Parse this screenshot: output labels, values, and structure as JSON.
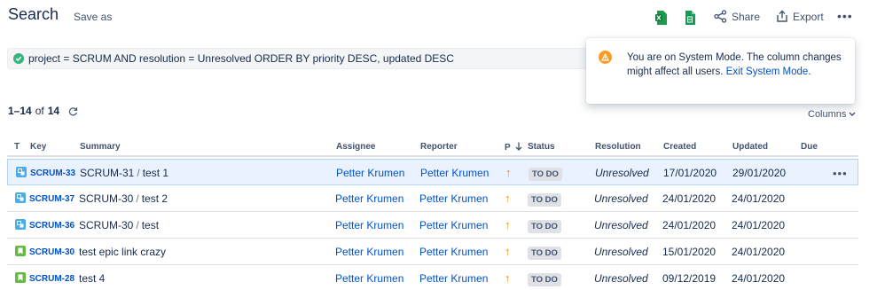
{
  "header": {
    "title": "Search",
    "save_as": "Save as",
    "share": "Share",
    "export": "Export",
    "more": "•••"
  },
  "jql": {
    "query": "project = SCRUM AND resolution = Unresolved ORDER BY priority DESC, updated DESC"
  },
  "popup": {
    "message": "You are on System Mode. The column changes might affect all users.",
    "link": "Exit System Mode",
    "suffix": "."
  },
  "results": {
    "range": "1–14",
    "of": "of",
    "total": "14",
    "columns_label": "Columns"
  },
  "table": {
    "headers": {
      "type": "T",
      "key": "Key",
      "summary": "Summary",
      "assignee": "Assignee",
      "reporter": "Reporter",
      "priority": "P",
      "status": "Status",
      "resolution": "Resolution",
      "created": "Created",
      "updated": "Updated",
      "due": "Due"
    },
    "rows": [
      {
        "type": "subtask",
        "key": "SCRUM-33",
        "parent": "SCRUM-31",
        "summary": "test 1",
        "assignee": "Petter Krumen",
        "reporter": "Petter Krumen",
        "priority": "↑",
        "status": "TO DO",
        "resolution": "Unresolved",
        "created": "17/01/2020",
        "updated": "29/01/2020",
        "more": "•••"
      },
      {
        "type": "subtask",
        "key": "SCRUM-37",
        "parent": "SCRUM-30",
        "summary": "test 2",
        "assignee": "Petter Krumen",
        "reporter": "Petter Krumen",
        "priority": "↑",
        "status": "TO DO",
        "resolution": "Unresolved",
        "created": "24/01/2020",
        "updated": "24/01/2020"
      },
      {
        "type": "subtask",
        "key": "SCRUM-36",
        "parent": "SCRUM-30",
        "summary": "test",
        "assignee": "Petter Krumen",
        "reporter": "Petter Krumen",
        "priority": "↑",
        "status": "TO DO",
        "resolution": "Unresolved",
        "created": "24/01/2020",
        "updated": "24/01/2020"
      },
      {
        "type": "story",
        "key": "SCRUM-30",
        "parent": "",
        "summary": "test epic link crazy",
        "assignee": "Petter Krumen",
        "reporter": "Petter Krumen",
        "priority": "↑",
        "status": "TO DO",
        "resolution": "Unresolved",
        "created": "15/01/2020",
        "updated": "24/01/2020"
      },
      {
        "type": "story",
        "key": "SCRUM-28",
        "parent": "",
        "summary": "test 4",
        "assignee": "Petter Krumen",
        "reporter": "Petter Krumen",
        "priority": "↑",
        "status": "TO DO",
        "resolution": "Unresolved",
        "created": "09/12/2019",
        "updated": "24/01/2020"
      }
    ]
  },
  "colors": {
    "link": "#0052cc",
    "text": "#172b4d",
    "subtask_icon": "#4bade8",
    "story_icon": "#65ba43",
    "priority_high": "#ff8b00",
    "warning": "#ff991f",
    "success": "#36b37e",
    "selected_row": "#e9f2fe"
  }
}
